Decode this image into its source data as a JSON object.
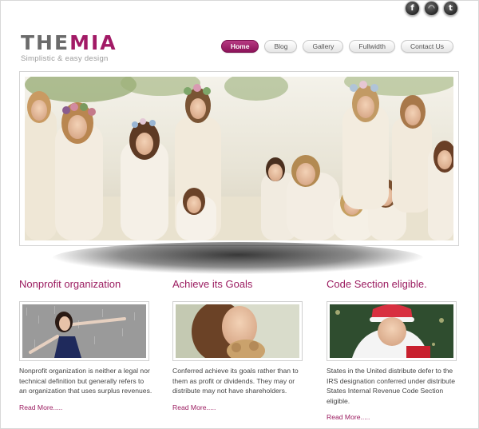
{
  "social": {
    "items": [
      {
        "name": "facebook",
        "glyph": "f"
      },
      {
        "name": "rss",
        "glyph": "◠"
      },
      {
        "name": "twitter",
        "glyph": "t"
      }
    ]
  },
  "logo": {
    "part1": "THE",
    "part2": "MIA",
    "tagline": "Simplistic & easy design"
  },
  "nav": {
    "items": [
      "Home",
      "Blog",
      "Gallery",
      "Fullwidth",
      "Contact Us"
    ],
    "active": "Home"
  },
  "colors": {
    "accent": "#9b1c60",
    "nav_active": "#a0236b"
  },
  "columns": [
    {
      "title": "Nonprofit organization",
      "text": "Nonprofit organization is neither a legal nor technical definition but generally refers to an organization that uses surplus revenues.",
      "link": "Read More....."
    },
    {
      "title": "Achieve its Goals",
      "text": "Conferred achieve its goals rather than to them as profit or dividends. They may or distribute may not have shareholders.",
      "link": "Read More....."
    },
    {
      "title": "Code Section eligible.",
      "text": "States in the United distribute defer to the IRS designation conferred under distribute States Internal Revenue Code Section eligible.",
      "link": "Read More....."
    }
  ]
}
